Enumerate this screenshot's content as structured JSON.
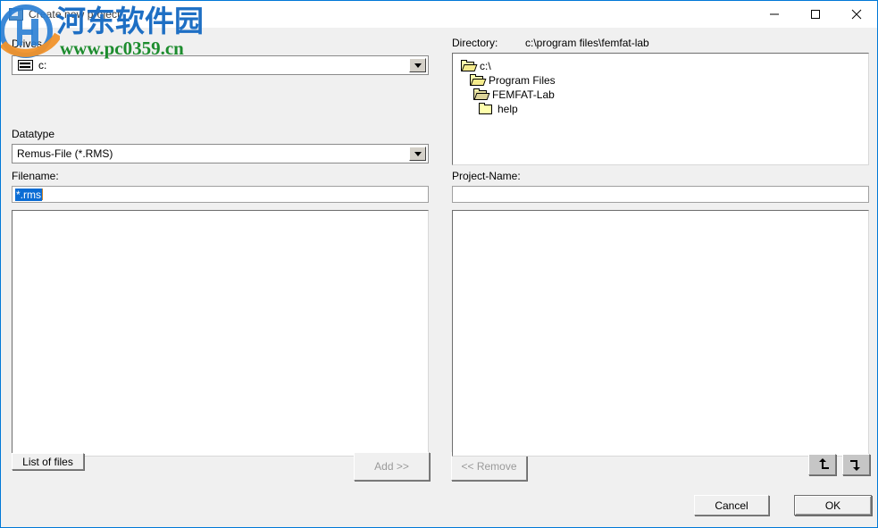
{
  "window": {
    "title": "Create new project",
    "icon": "app-icon",
    "minimize_label": "minimize-icon",
    "maximize_label": "maximize-icon",
    "close_label": "close-icon",
    "border_color": "#0078d7"
  },
  "left_panel": {
    "drives_label": "Drives",
    "drive_combo": {
      "value": "c:",
      "icon": "drive-icon"
    },
    "datatype_label": "Datatype",
    "datatype_combo": {
      "value": "Remus-File (*.RMS)"
    },
    "filename_label": "Filename:",
    "filename_input": {
      "value": "*.rms",
      "selected": true
    },
    "file_list": {
      "items": []
    },
    "list_of_files_button": "List of files",
    "add_button": "Add >>",
    "remove_button": "<< Remove"
  },
  "right_panel": {
    "directory_label": "Directory:",
    "directory_path": "c:\\program files\\femfat-lab",
    "tree": [
      {
        "label": "c:\\",
        "indent": 0,
        "icon": "folder-open-icon",
        "selected": false
      },
      {
        "label": "Program Files",
        "indent": 1,
        "icon": "folder-open-icon",
        "selected": false
      },
      {
        "label": "FEMFAT-Lab",
        "indent": 2,
        "icon": "folder-open-icon",
        "selected": true
      },
      {
        "label": "help",
        "indent": 3,
        "icon": "folder-closed-icon",
        "selected": false
      }
    ],
    "project_name_label": "Project-Name:",
    "project_name_input": {
      "value": "",
      "placeholder": ""
    },
    "project_list": {
      "items": []
    },
    "move_up_button": "move-up-icon",
    "move_down_button": "move-down-icon"
  },
  "footer": {
    "cancel_button": "Cancel",
    "ok_button": "OK"
  },
  "watermark": {
    "site_name": "河东软件园",
    "url": "www.pc0359.cn",
    "cn_color": "#1e6fc4",
    "url_color": "#1d8c2e"
  }
}
